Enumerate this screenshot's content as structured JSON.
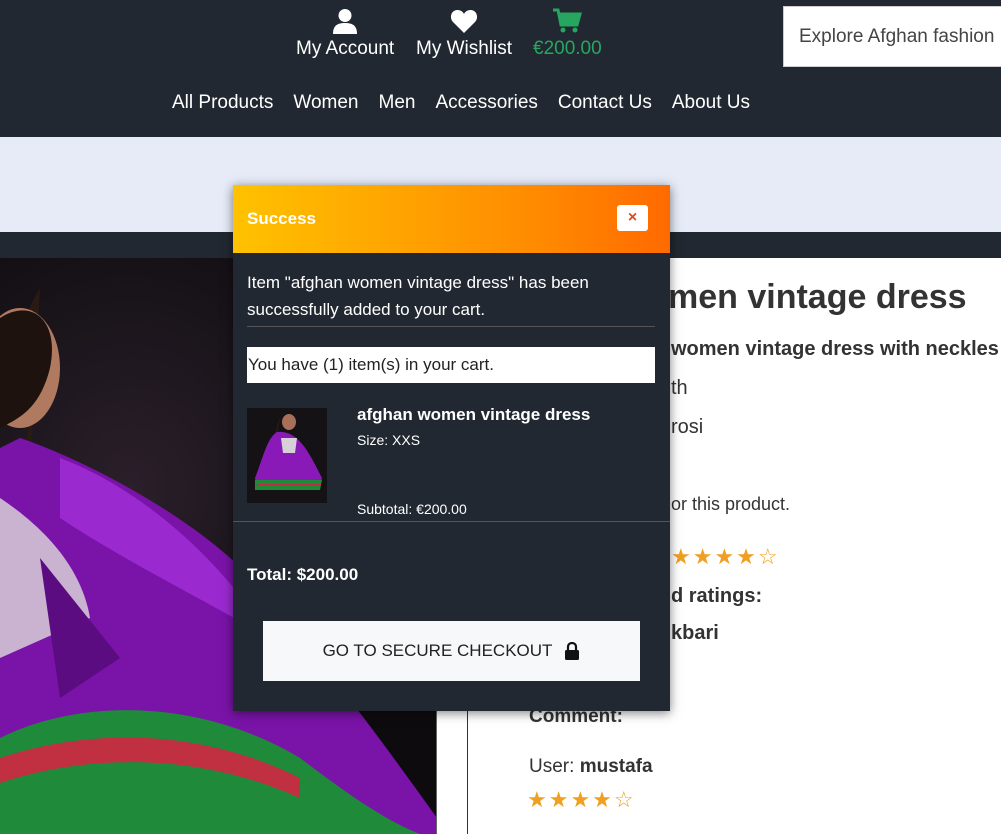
{
  "header": {
    "account_label": "My Account",
    "wishlist_label": "My Wishlist",
    "cart_total": "€200.00",
    "search_placeholder": "Explore Afghan fashion",
    "nav": [
      "All Products",
      "Women",
      "Men",
      "Accessories",
      "Contact Us",
      "About Us"
    ]
  },
  "product": {
    "title_partial": "men vintage dress",
    "desc_partial": "women vintage dress with neckles",
    "line2_partial": "th",
    "line3_partial": "rosi",
    "reviews_note_partial": "or this product.",
    "rating_stars_top": "★★★★☆",
    "ratings_label_partial": "d ratings:",
    "reviewer1_partial": "kbari",
    "comment_label": "Comment:",
    "user_label": "User:",
    "user_name": "mustafa",
    "rating_stars_bottom": "★★★★☆"
  },
  "modal": {
    "title": "Success",
    "close": "×",
    "message": "Item \"afghan women vintage dress\" has been successfully added to your cart.",
    "count_text": "You have (1) item(s) in your cart.",
    "item_name": "afghan women vintage dress",
    "item_size": "Size: XXS",
    "item_subtotal": "Subtotal: €200.00",
    "total": "Total: $200.00",
    "checkout_label": "GO TO SECURE CHECKOUT"
  },
  "colors": {
    "header_bg": "#222831",
    "accent_green": "#27a660",
    "band": "#e6ebf7",
    "star": "#f0a020",
    "modal_head_start": "#ffc200",
    "modal_head_end": "#ff6a00"
  },
  "icons": [
    "user-icon",
    "heart-icon",
    "cart-icon",
    "lock-icon",
    "close-icon",
    "star-icon"
  ]
}
